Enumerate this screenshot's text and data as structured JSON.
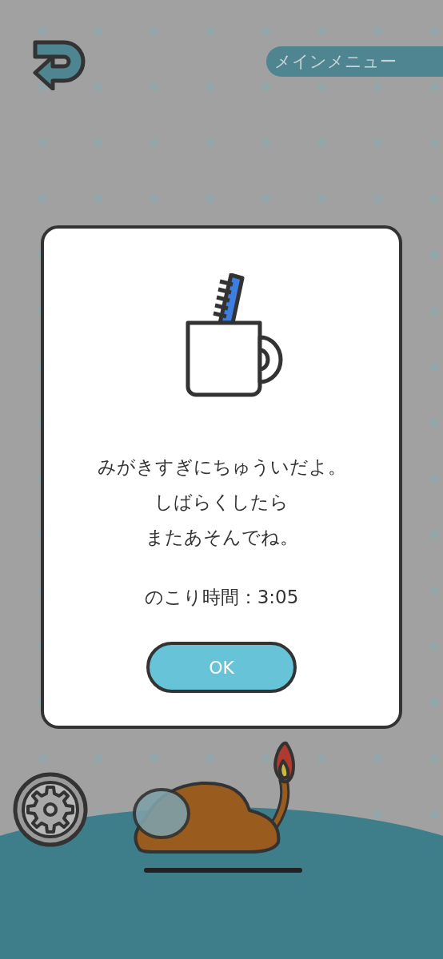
{
  "header": {
    "menu_button": "メインメニュー"
  },
  "dialog": {
    "message_lines": [
      "みがきすぎにちゅういだよ。",
      "しばらくしたら",
      "またあそんでね。"
    ],
    "timer": "のこり時間：3:05",
    "ok_button": "OK"
  }
}
